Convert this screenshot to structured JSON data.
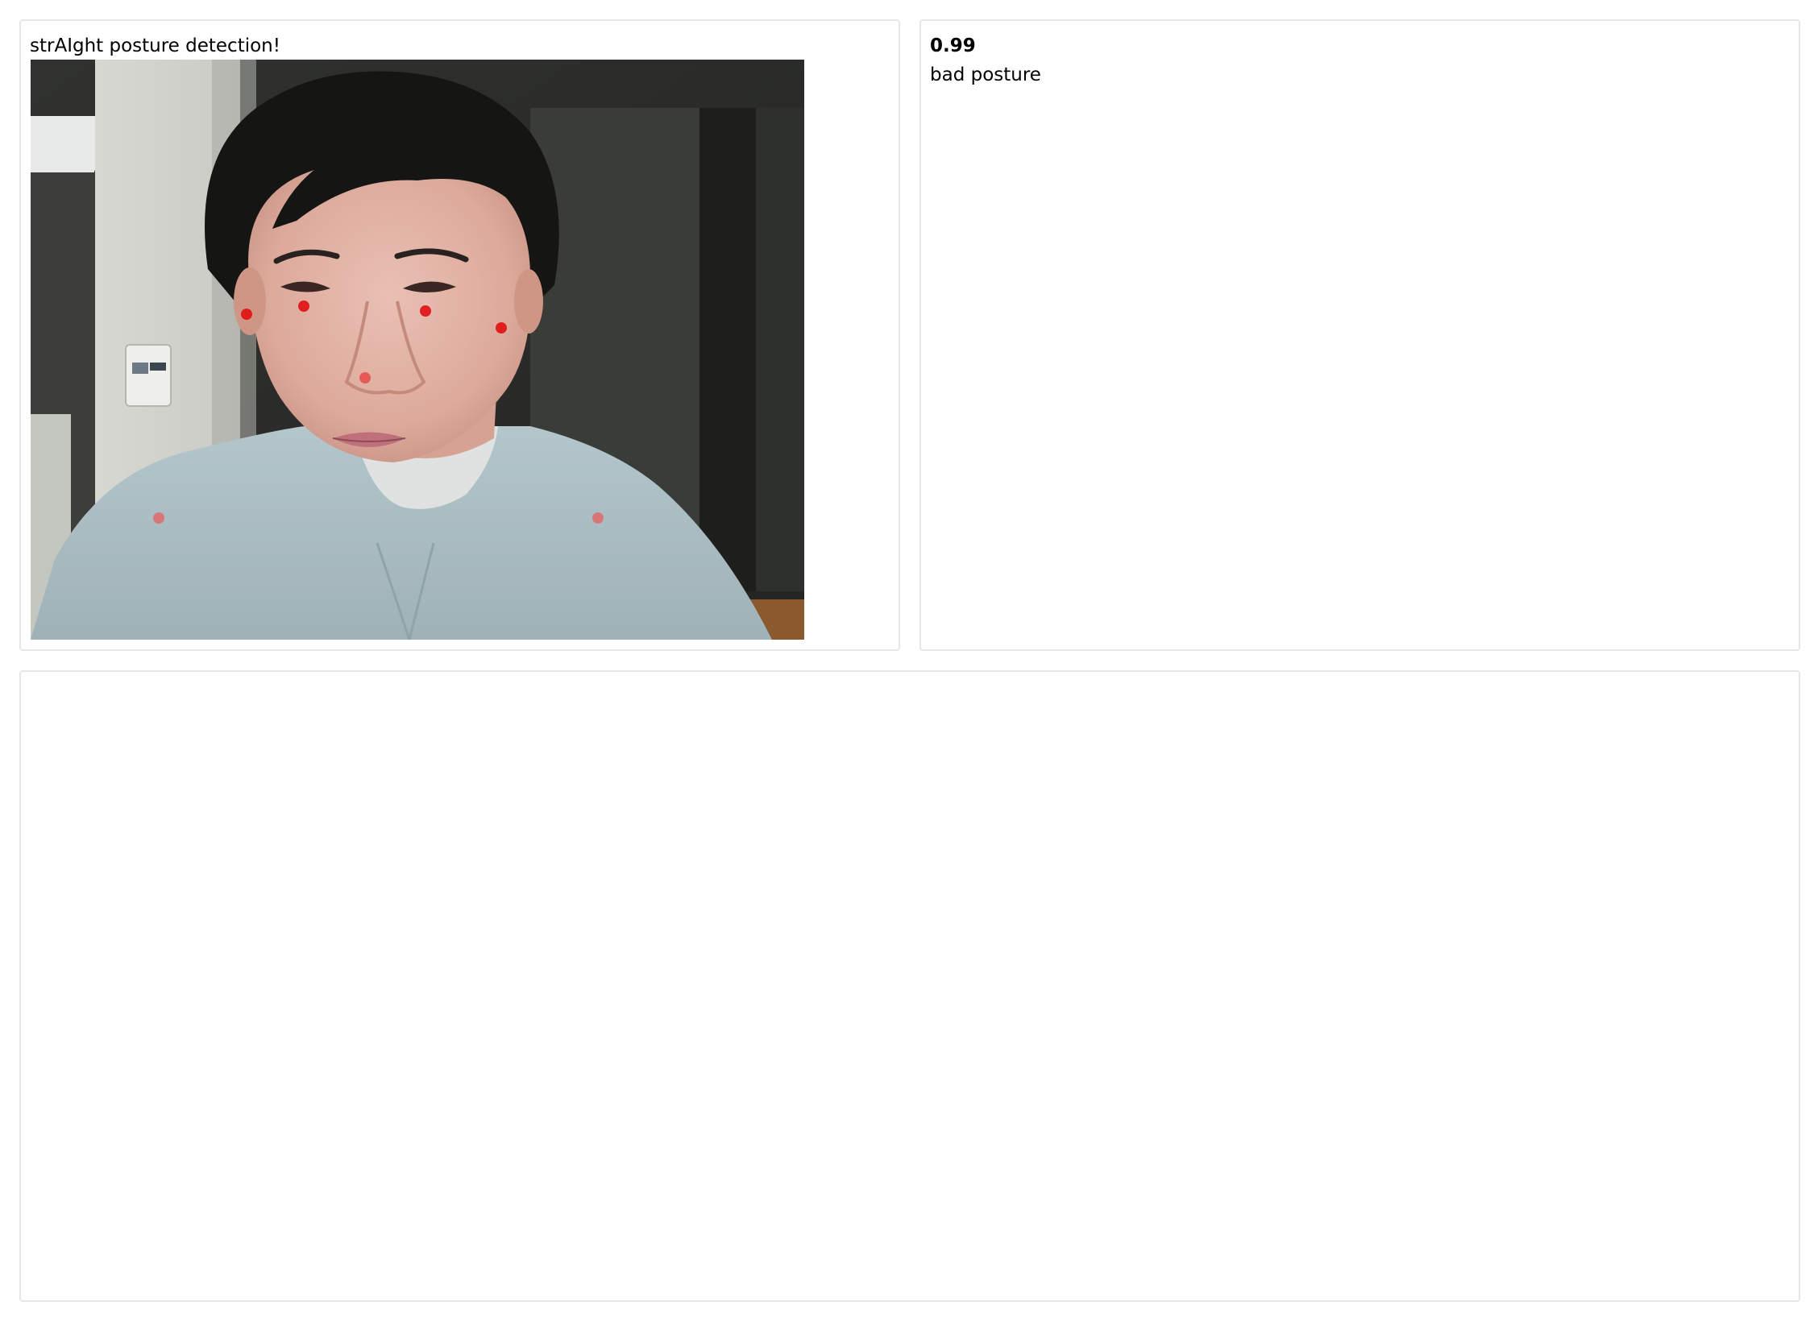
{
  "app": {
    "title": "strAIght posture detection!"
  },
  "video_panel": {
    "title": "strAIght posture detection!",
    "feed_description": "webcam",
    "keypoint_color": "#e01010",
    "keypoints": [
      "left-ear",
      "left-eye",
      "right-eye",
      "right-ear",
      "nose",
      "left-shoulder",
      "right-shoulder"
    ]
  },
  "result_panel": {
    "score": "0.99",
    "label": "bad posture"
  },
  "bottom_panel": {}
}
